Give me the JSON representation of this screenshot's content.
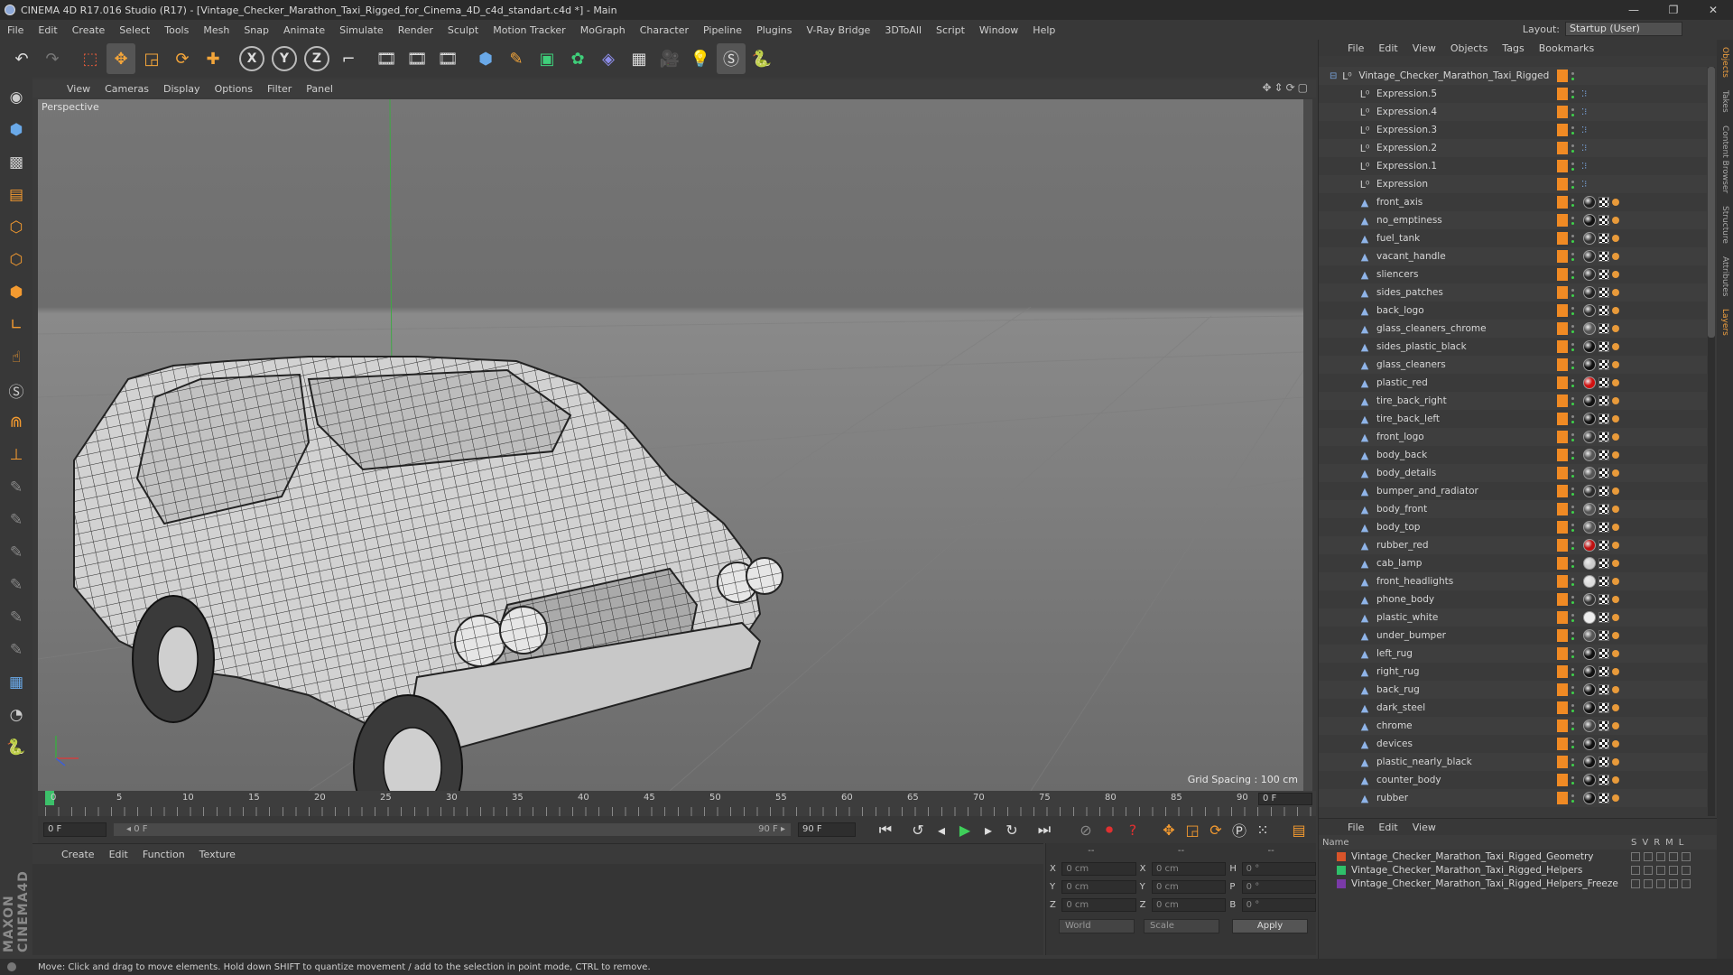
{
  "app": {
    "title": "CINEMA 4D R17.016 Studio (R17) - [Vintage_Checker_Marathon_Taxi_Rigged_for_Cinema_4D_c4d_standart.c4d *] - Main",
    "window_controls": [
      "—",
      "❐",
      "✕"
    ]
  },
  "menubar": {
    "items": [
      "File",
      "Edit",
      "Create",
      "Select",
      "Tools",
      "Mesh",
      "Snap",
      "Animate",
      "Simulate",
      "Render",
      "Sculpt",
      "Motion Tracker",
      "MoGraph",
      "Character",
      "Pipeline",
      "Plugins",
      "V-Ray Bridge",
      "3DToAll",
      "Script",
      "Window",
      "Help"
    ]
  },
  "layout": {
    "label": "Layout:",
    "value": "Startup (User)"
  },
  "toolbar": {
    "tools": [
      "undo-icon",
      "redo-icon",
      "live-select-icon",
      "move-icon",
      "scale-icon",
      "rotate-icon",
      "move-cross-icon"
    ],
    "axes": [
      "X",
      "Y",
      "Z"
    ],
    "coord_system": "world-coord-icon",
    "render": [
      "render-view-icon",
      "render-picture-viewer-icon",
      "edit-render-settings-icon"
    ],
    "objects": [
      "cube-icon",
      "pen-spline-icon",
      "subdivision-icon",
      "cloner-icon",
      "deformer-icon",
      "floor-icon",
      "camera-icon",
      "light-icon",
      "script-s-icon",
      "python-icon"
    ]
  },
  "left_tools": [
    "model-mode-icon",
    "object-mode-icon",
    "texture-mode-icon",
    "workplane-icon",
    "points-mode-icon",
    "edges-mode-icon",
    "polygons-mode-icon",
    "axis-icon",
    "tweak-icon",
    "snapping-s-icon",
    "magnet-icon",
    "joint-icon",
    "brush-1-icon",
    "brush-2-icon",
    "brush-3-icon",
    "brush-4-icon",
    "brush-5-icon",
    "brush-6-icon",
    "grid-lock-icon",
    "paint-icon",
    "python-icon"
  ],
  "maxon": "MAXON CINEMA4D",
  "viewport": {
    "menu": [
      "View",
      "Cameras",
      "Display",
      "Options",
      "Filter",
      "Panel"
    ],
    "label": "Perspective",
    "grid_spacing": "Grid Spacing : 100 cm"
  },
  "timeline": {
    "ticks": [
      "0",
      "5",
      "10",
      "15",
      "20",
      "25",
      "30",
      "35",
      "40",
      "45",
      "50",
      "55",
      "60",
      "65",
      "70",
      "75",
      "80",
      "85",
      "90"
    ],
    "current_frame": "0 F",
    "start_field": "0 F",
    "range_start": "◂ 0 F",
    "range_end": "90 F ▸",
    "end_field": "90 F"
  },
  "transport": [
    "go-start-icon",
    "prev-key-icon",
    "prev-frame-icon",
    "play-icon",
    "next-frame-icon",
    "loop-icon",
    "go-end-icon",
    "record-keys-icon",
    "autokey-icon",
    "key-help-icon",
    "move-key-icon",
    "scale-key-icon",
    "rotate-key-icon",
    "param-key-icon",
    "pla-key-icon",
    "timeline-icon"
  ],
  "material_panel": {
    "menu": [
      "Create",
      "Edit",
      "Function",
      "Texture"
    ]
  },
  "coords": {
    "header": [
      "--",
      "--",
      "--"
    ],
    "rows": [
      {
        "a": "X",
        "av": "0 cm",
        "b": "X",
        "bv": "0 cm",
        "c": "H",
        "cv": "0 °"
      },
      {
        "a": "Y",
        "av": "0 cm",
        "b": "Y",
        "bv": "0 cm",
        "c": "P",
        "cv": "0 °"
      },
      {
        "a": "Z",
        "av": "0 cm",
        "b": "Z",
        "bv": "0 cm",
        "c": "B",
        "cv": "0 °"
      }
    ],
    "mode": "World",
    "transform": "Scale",
    "apply": "Apply"
  },
  "status": "Move: Click and drag to move elements. Hold down SHIFT to quantize movement / add to the selection in point mode, CTRL to remove.",
  "objects": {
    "menu": [
      "File",
      "Edit",
      "View",
      "Objects",
      "Tags",
      "Bookmarks"
    ],
    "root": "Vintage_Checker_Marathon_Taxi_Rigged",
    "expressions": [
      "Expression.5",
      "Expression.4",
      "Expression.3",
      "Expression.2",
      "Expression.1",
      "Expression"
    ],
    "items": [
      {
        "name": "front_axis",
        "mat": "#1e1e1e"
      },
      {
        "name": "no_emptiness",
        "mat": "#111111"
      },
      {
        "name": "fuel_tank",
        "mat": "#333333"
      },
      {
        "name": "vacant_handle",
        "mat": "#2a2a2a"
      },
      {
        "name": "sliencers",
        "mat": "#2a2a2a"
      },
      {
        "name": "sides_patches",
        "mat": "#222222"
      },
      {
        "name": "back_logo",
        "mat": "#2a2a2a"
      },
      {
        "name": "glass_cleaners_chrome",
        "mat": "#555555"
      },
      {
        "name": "sides_plastic_black",
        "mat": "#111111"
      },
      {
        "name": "glass_cleaners",
        "mat": "#111111"
      },
      {
        "name": "plastic_red",
        "mat": "#d01010"
      },
      {
        "name": "tire_back_right",
        "mat": "#111111"
      },
      {
        "name": "tire_back_left",
        "mat": "#111111"
      },
      {
        "name": "front_logo",
        "mat": "#333333"
      },
      {
        "name": "body_back",
        "mat": "#555555"
      },
      {
        "name": "body_details",
        "mat": "#555555"
      },
      {
        "name": "bumper_and_radiator",
        "mat": "#2a2a2a"
      },
      {
        "name": "body_front",
        "mat": "#555555"
      },
      {
        "name": "body_top",
        "mat": "#555555"
      },
      {
        "name": "rubber_red",
        "mat": "#c01010"
      },
      {
        "name": "cab_lamp",
        "mat": "#cccccc"
      },
      {
        "name": "front_headlights",
        "mat": "#dddddd"
      },
      {
        "name": "phone_body",
        "mat": "#333333"
      },
      {
        "name": "plastic_white",
        "mat": "#eeeeee"
      },
      {
        "name": "under_bumper",
        "mat": "#555555"
      },
      {
        "name": "left_rug",
        "mat": "#111111"
      },
      {
        "name": "right_rug",
        "mat": "#111111"
      },
      {
        "name": "back_rug",
        "mat": "#111111"
      },
      {
        "name": "dark_steel",
        "mat": "#111111"
      },
      {
        "name": "chrome",
        "mat": "#444444"
      },
      {
        "name": "devices",
        "mat": "#111111"
      },
      {
        "name": "plastic_nearly_black",
        "mat": "#111111"
      },
      {
        "name": "counter_body",
        "mat": "#111111"
      },
      {
        "name": "rubber",
        "mat": "#111111"
      }
    ]
  },
  "right_tabs": [
    "Objects",
    "Takes",
    "Content Browser",
    "Structure",
    "Attributes",
    "Layers"
  ],
  "layers": {
    "menu": [
      "File",
      "Edit",
      "View"
    ],
    "name_header": "Name",
    "col_headers": [
      "S",
      "V",
      "R",
      "M",
      "L"
    ],
    "rows": [
      {
        "name": "Vintage_Checker_Marathon_Taxi_Rigged_Geometry",
        "color": "#d8542a"
      },
      {
        "name": "Vintage_Checker_Marathon_Taxi_Rigged_Helpers",
        "color": "#2fc06a"
      },
      {
        "name": "Vintage_Checker_Marathon_Taxi_Rigged_Helpers_Freeze",
        "color": "#7a3aa8"
      }
    ]
  }
}
